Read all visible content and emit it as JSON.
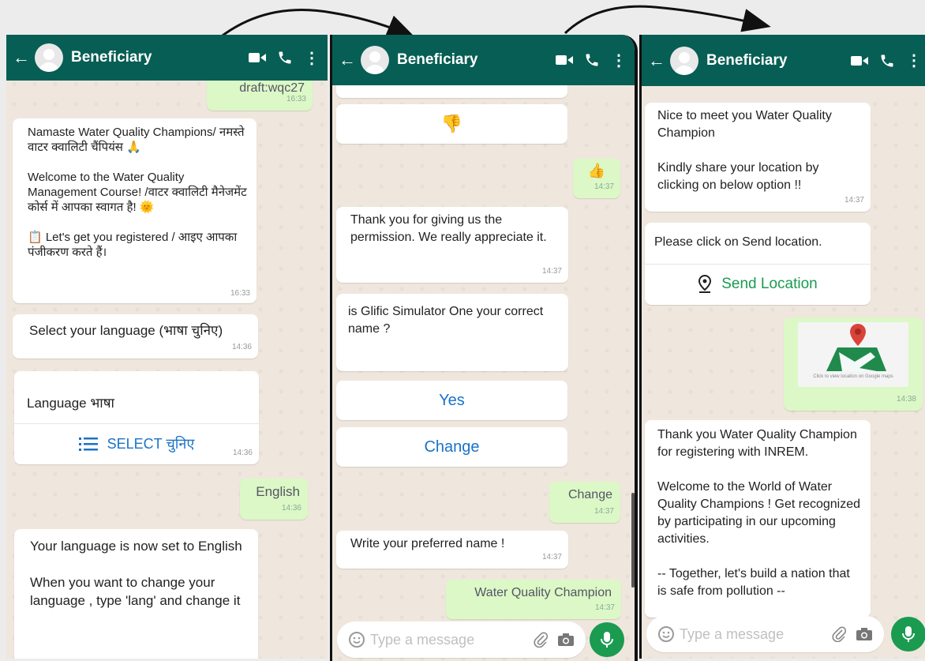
{
  "header": {
    "contact_name": "Beneficiary"
  },
  "composer": {
    "placeholder": "Type a message"
  },
  "panel1": {
    "draft_text": "draft:wqc27",
    "draft_time": "16:33",
    "welcome_text": "Namaste Water Quality Champions/ नमस्ते वाटर क्वालिटी चैंपियंस 🙏\n\nWelcome to the Water Quality Management Course! /वाटर क्वालिटी मैनेजमेंट कोर्स में आपका स्वागत है! 🌞\n\n📋 Let's get you registered / आइए आपका पंजीकरण करते हैं।",
    "welcome_time": "16:33",
    "select_lang_text": "Select your language (भाषा चुनिए)",
    "select_lang_time": "14:36",
    "language_label": "Language भाषा",
    "select_button": "SELECT चुनिए",
    "language_time": "14:36",
    "english_text": "English",
    "english_time": "14:36",
    "set_text": "Your language is now set to English\n\nWhen you want to change your language , type 'lang' and change it"
  },
  "panel2": {
    "thumbs_down": "👎",
    "thumbs_up": "👍",
    "thumbs_up_time": "14:37",
    "thanks_text": "Thank you for giving us the permission. We really appreciate it.",
    "thanks_time": "14:37",
    "name_question": "is Glific Simulator One your correct name ?",
    "yes_button": "Yes",
    "change_button": "Change",
    "change_reply": "Change",
    "change_time": "14:37",
    "preferred_text": "Write your preferred name !",
    "preferred_time": "14:37",
    "name_reply": "Water Quality Champion",
    "name_time": "14:37"
  },
  "panel3": {
    "meet_text": "Nice to meet you Water Quality Champion\n\nKindly share your location by clicking on below option !!",
    "meet_time": "14:37",
    "click_text": "Please click on Send location.",
    "send_location_button": "Send Location",
    "map_caption": "Click to view location on Google maps",
    "map_time": "14:38",
    "registered_text": "Thank you Water Quality Champion for registering with INREM.\n\nWelcome to the World of Water Quality Champions ! Get recognized by participating in our upcoming activities.\n\n-- Together, let's build a nation that is safe from pollution --"
  },
  "colors": {
    "header": "#075e54",
    "accent": "#1a9b50",
    "outgoing": "#dcf8c6"
  }
}
